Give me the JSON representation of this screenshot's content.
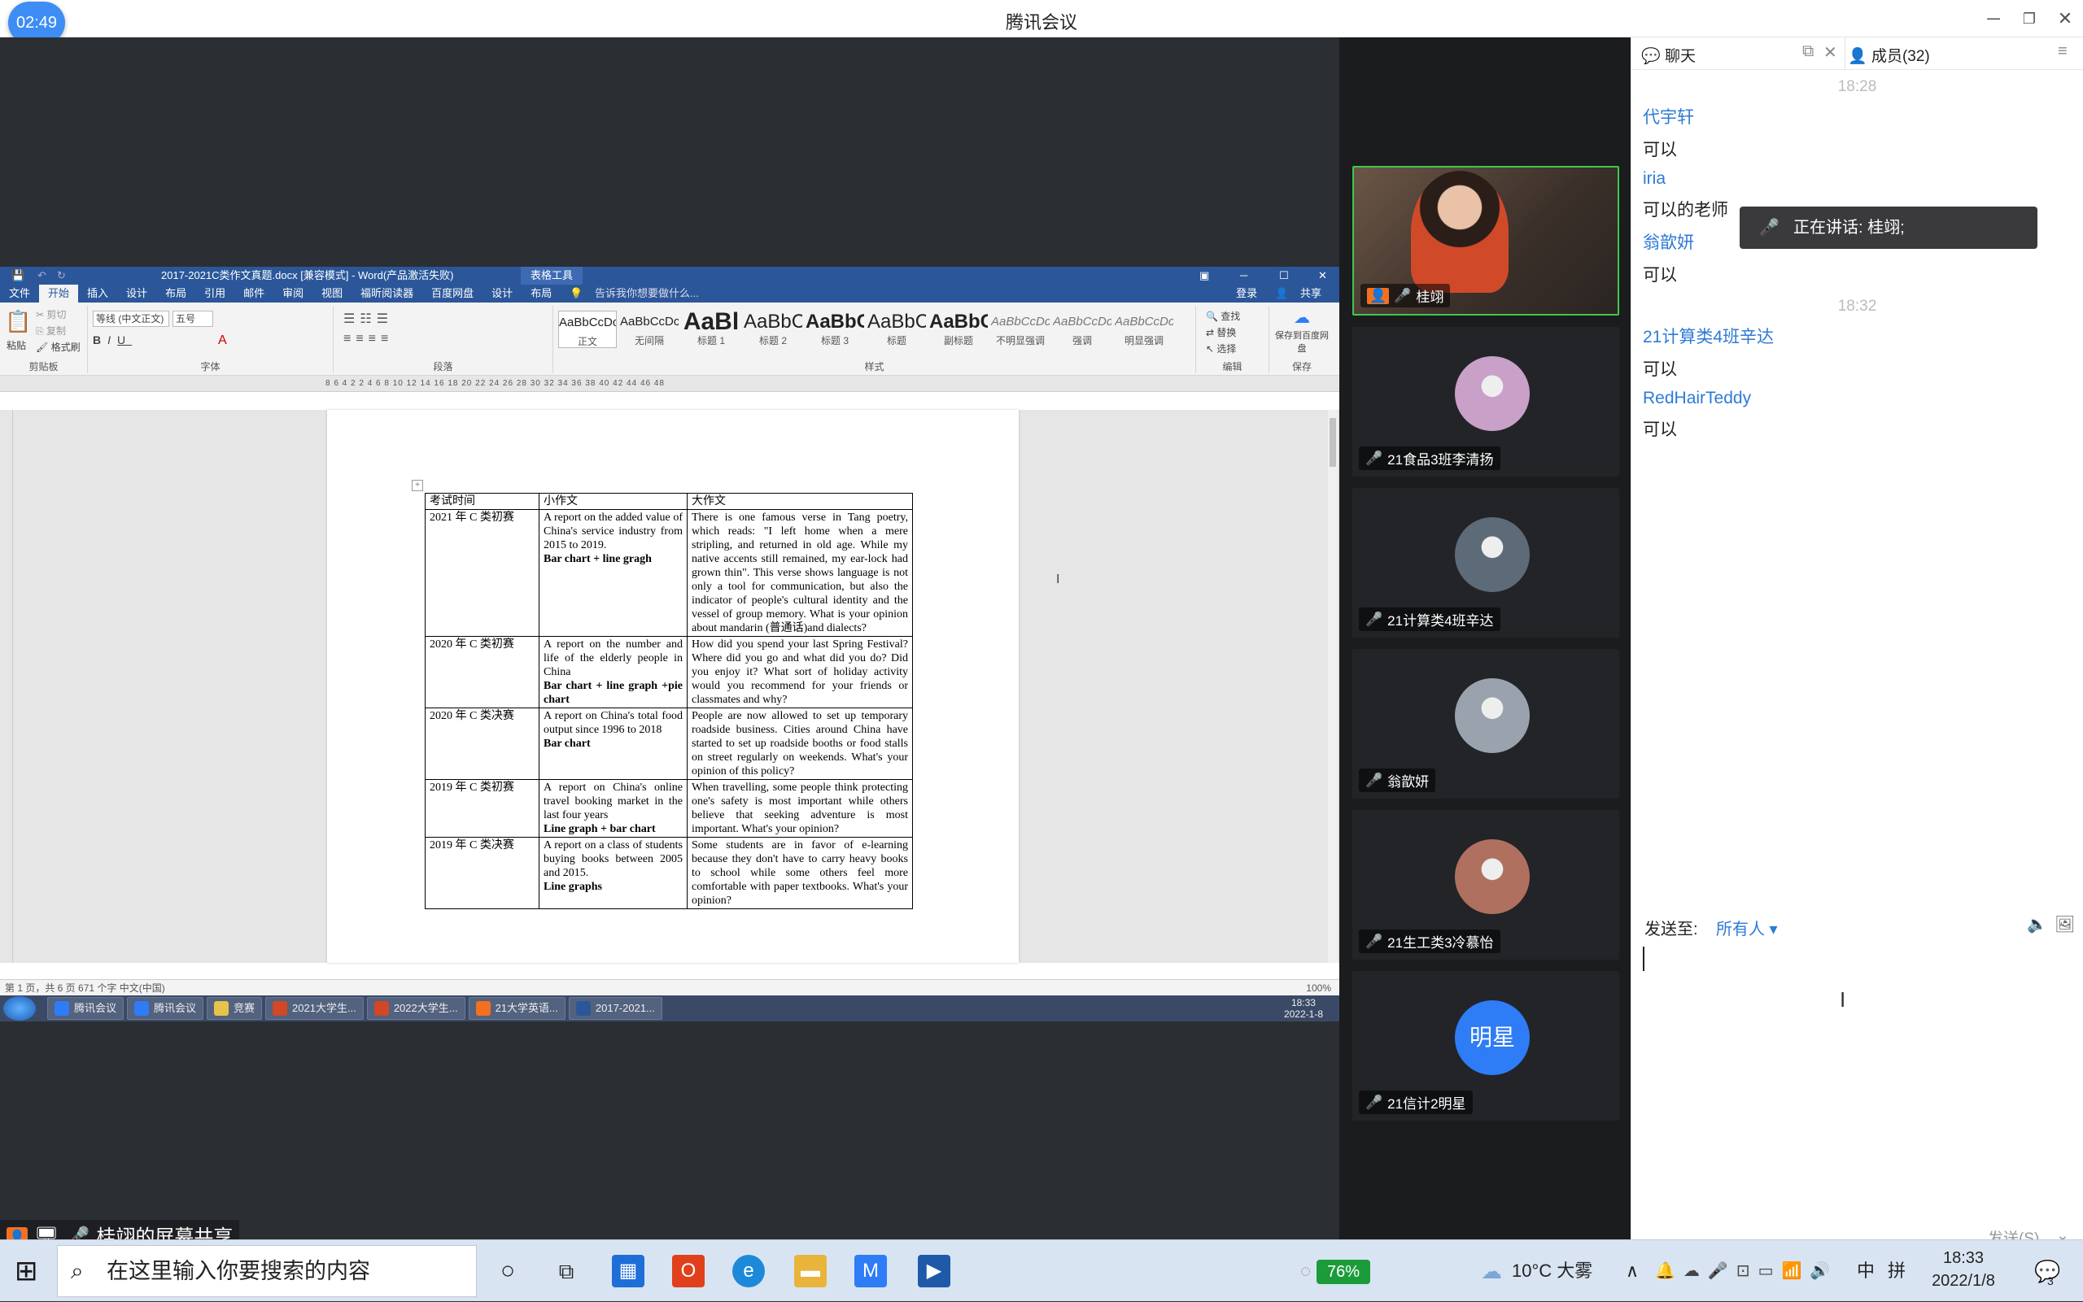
{
  "app": {
    "title": "腾讯会议",
    "timer": "02:49"
  },
  "share": {
    "label": "桂翊的屏幕共享"
  },
  "word": {
    "doc_title": "2017-2021C类作文真题.docx [兼容模式] - Word(产品激活失败)",
    "context_tab": "表格工具",
    "tabs": [
      "文件",
      "开始",
      "插入",
      "设计",
      "布局",
      "引用",
      "邮件",
      "审阅",
      "视图",
      "福昕阅读器",
      "百度网盘",
      "设计",
      "布局"
    ],
    "tell_me": "告诉我你想要做什么...",
    "login": "登录",
    "share_btn": "共享",
    "clipboard": {
      "paste": "粘贴",
      "cut": "剪切",
      "copy": "复制",
      "format_painter": "格式刷",
      "group": "剪贴板"
    },
    "font": {
      "name": "等线 (中文正文)",
      "size": "五号",
      "group": "字体"
    },
    "paragraph_group": "段落",
    "styles": [
      {
        "preview": "AaBbCcDc",
        "label": "正文"
      },
      {
        "preview": "AaBbCcDc",
        "label": "无间隔"
      },
      {
        "preview": "AaBl",
        "label": "标题 1"
      },
      {
        "preview": "AaBbC",
        "label": "标题 2"
      },
      {
        "preview": "AaBbC",
        "label": "标题 3"
      },
      {
        "preview": "AaBbC",
        "label": "标题"
      },
      {
        "preview": "AaBbC",
        "label": "副标题"
      },
      {
        "preview": "AaBbCcDc",
        "label": "不明显强调"
      },
      {
        "preview": "AaBbCcDc",
        "label": "强调"
      },
      {
        "preview": "AaBbCcDc",
        "label": "明显强调"
      }
    ],
    "styles_group": "样式",
    "editing": {
      "find": "查找",
      "replace": "替换",
      "select": "选择",
      "group": "编辑"
    },
    "save": {
      "label": "保存到百度网盘",
      "group": "保存"
    },
    "ruler": "8 6 4 2 2 4 6 8 10 12 14 16 18 20 22 24 26 28 30 32 34 36 38 40 42 44 46 48",
    "table": {
      "headers": [
        "考试时间",
        "小作文",
        "大作文"
      ],
      "rows": [
        {
          "time": "2021 年 C 类初赛",
          "small": "A report on the added value of China's service industry from 2015 to 2019.",
          "small_bold": "Bar chart + line gragh",
          "big": "There is one famous verse in Tang poetry, which reads: \"I left home when a mere stripling, and returned in old age. While my native accents still remained, my ear-lock had grown thin\". This verse shows language is not only a tool for communication, but also the indicator of people's cultural identity and the vessel of group memory. What is your opinion about mandarin (普通话)and dialects?"
        },
        {
          "time": "2020 年 C 类初赛",
          "small": "A report on the number and life of the elderly people in China",
          "small_bold": "Bar chart + line graph +pie chart",
          "big": "How did you spend your last Spring Festival? Where did you go and what did you do? Did you enjoy it? What sort of holiday activity would you recommend for your friends or classmates and why?"
        },
        {
          "time": "2020 年 C 类决赛",
          "small": "A report on China's total food output since 1996 to 2018",
          "small_bold": "Bar chart",
          "big": "People are now allowed to set up temporary roadside business. Cities around China have started to set up roadside booths or food stalls on street regularly on weekends. What's your opinion of this policy?"
        },
        {
          "time": "2019 年 C 类初赛",
          "small": "A report on China's online travel booking market in the last four years",
          "small_bold": "Line graph + bar chart",
          "big": "When travelling, some people think protecting one's safety is most important while others believe that seeking adventure is most important. What's your opinion?"
        },
        {
          "time": "2019 年 C 类决赛",
          "small": "A report on a class of students buying books between 2005 and 2015.",
          "small_bold": "Line graphs",
          "big": "Some students are in favor of e-learning because they don't have to carry heavy books to school while some others feel more comfortable with paper textbooks. What's your opinion?"
        }
      ]
    },
    "status": "第 1 页，共 6 页    671 个字    中文(中国)",
    "zoom": "100%",
    "taskbar": [
      {
        "label": "腾讯会议",
        "color": "#2e7cf6"
      },
      {
        "label": "腾讯会议",
        "color": "#2e7cf6"
      },
      {
        "label": "竞赛",
        "color": "#e8c34a"
      },
      {
        "label": "2021大学生...",
        "color": "#d24726"
      },
      {
        "label": "2022大学生...",
        "color": "#d24726"
      },
      {
        "label": "21大学英语...",
        "color": "#f37021"
      },
      {
        "label": "2017-2021...",
        "color": "#2b579a"
      }
    ],
    "clock_time": "18:33",
    "clock_date": "2022-1-8"
  },
  "videos": [
    {
      "name": "桂翊",
      "avatar_text": "",
      "avatar_color": "#8a6d5a",
      "speaking": true
    },
    {
      "name": "21食品3班李清扬",
      "avatar_text": "",
      "avatar_color": "#c9a0c8",
      "speaking": false
    },
    {
      "name": "21计算类4班辛达",
      "avatar_text": "",
      "avatar_color": "#5d6b78",
      "speaking": false
    },
    {
      "name": "翁歆妍",
      "avatar_text": "",
      "avatar_color": "#9aa3ad",
      "speaking": false
    },
    {
      "name": "21生工类3冷慕怡",
      "avatar_text": "",
      "avatar_color": "#b07060",
      "speaking": false
    },
    {
      "name": "21信计2明星",
      "avatar_text": "明星",
      "avatar_color": "#2e7cf6",
      "speaking": false
    }
  ],
  "chat": {
    "tab_chat": "聊天",
    "tab_members": "成员(32)",
    "messages": [
      {
        "type": "time",
        "text": "18:28"
      },
      {
        "type": "name",
        "text": "代宇轩"
      },
      {
        "type": "text",
        "text": "可以"
      },
      {
        "type": "name",
        "text": "iria"
      },
      {
        "type": "text",
        "text": "可以的老师"
      },
      {
        "type": "name",
        "text": "翁歆妍"
      },
      {
        "type": "text",
        "text": "可以"
      },
      {
        "type": "time",
        "text": "18:32"
      },
      {
        "type": "name",
        "text": "21计算类4班辛达"
      },
      {
        "type": "text",
        "text": "可以"
      },
      {
        "type": "name",
        "text": "RedHairTeddy"
      },
      {
        "type": "text",
        "text": "可以"
      }
    ],
    "speaking_banner": "正在讲话: 桂翊;",
    "send_to_label": "发送至:",
    "send_to_value": "所有人",
    "send_button": "发送(S)"
  },
  "os": {
    "search_placeholder": "在这里输入你要搜索的内容",
    "battery": "76%",
    "weather": "10°C  大雾",
    "ime": "中",
    "ime2": "拼",
    "time": "18:33",
    "date": "2022/1/8",
    "notif_count": "3"
  }
}
